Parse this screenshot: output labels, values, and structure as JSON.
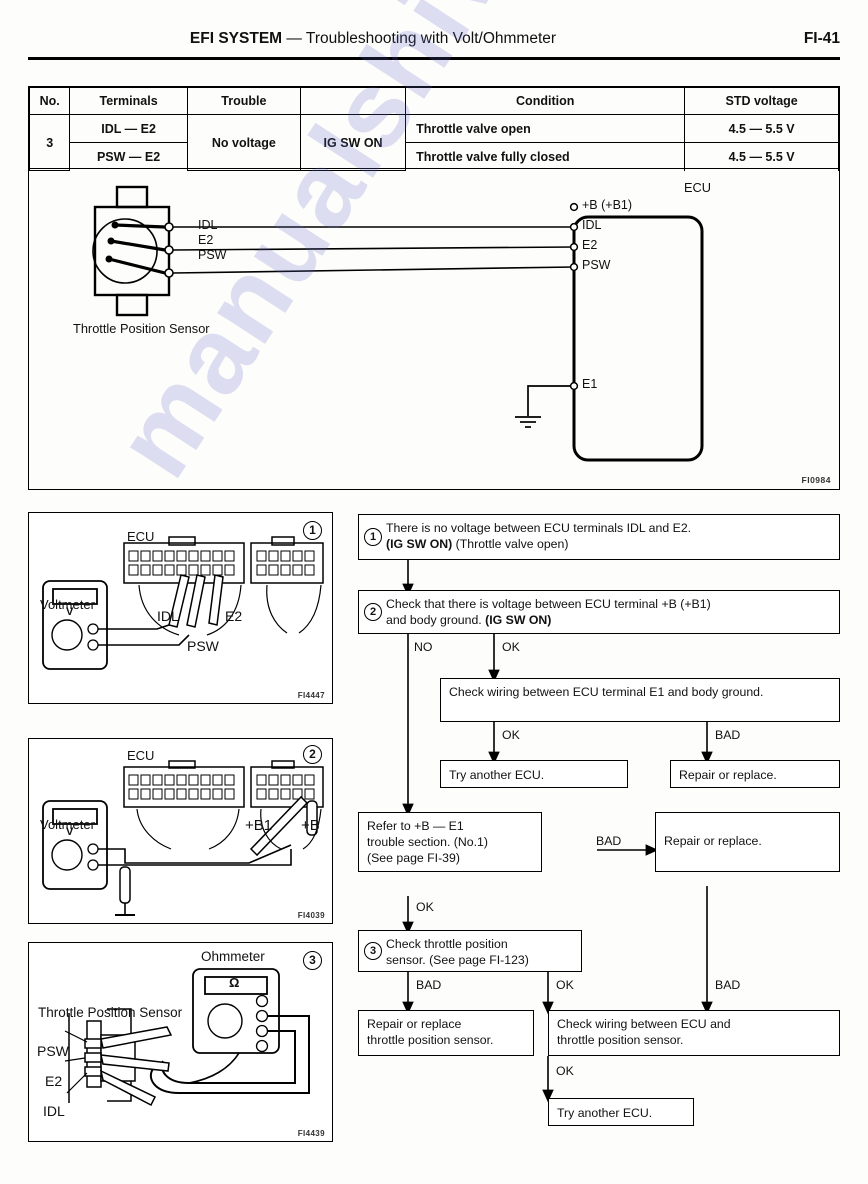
{
  "header": {
    "system": "EFI SYSTEM",
    "dash": "—",
    "subtitle": "Troubleshooting with Volt/Ohmmeter",
    "page": "FI-41"
  },
  "spec_table": {
    "columns": [
      "No.",
      "Terminals",
      "Trouble",
      "",
      "Condition",
      "STD voltage"
    ],
    "no": "3",
    "rows": [
      {
        "terminals": "IDL — E2",
        "trouble": "No voltage",
        "switch": "IG SW ON",
        "condition": "Throttle valve open",
        "std_voltage": "4.5 — 5.5 V"
      },
      {
        "terminals": "PSW — E2",
        "condition": "Throttle valve fully closed",
        "std_voltage": "4.5 — 5.5 V"
      }
    ]
  },
  "wiring_diagram": {
    "sensor_label": "Throttle Position Sensor",
    "ecu_label": "ECU",
    "sensor_terminals": [
      "IDL",
      "E2",
      "PSW"
    ],
    "ecu_terminals": [
      "+B (+B1)",
      "IDL",
      "E2",
      "PSW"
    ],
    "ecu_ground_terminal": "E1",
    "fig_code": "FI0984"
  },
  "illustrations": [
    {
      "num": "1",
      "meter_label": "Voltmeter",
      "meter_symbol": "V",
      "device_label": "ECU",
      "terminal_labels": [
        "IDL",
        "PSW",
        "E2"
      ],
      "fig_code": "FI4447"
    },
    {
      "num": "2",
      "meter_label": "Voltmeter",
      "meter_symbol": "V",
      "device_label": "ECU",
      "terminal_labels": [
        "+B1",
        "+B"
      ],
      "fig_code": "FI4039"
    },
    {
      "num": "3",
      "meter_label": "Ohmmeter",
      "meter_symbol": "Ω",
      "device_label": "Throttle Position Sensor",
      "terminal_labels": [
        "PSW",
        "E2",
        "IDL"
      ],
      "fig_code": "FI4439"
    }
  ],
  "flowchart": {
    "step1": {
      "num": "1",
      "line1": "There is no voltage between ECU terminals IDL and E2.",
      "bold": "(IG SW ON)",
      "tail": " (Throttle valve open)"
    },
    "step2": {
      "num": "2",
      "line1": "Check that there is voltage between ECU terminal +B (+B1)",
      "line2a": "and body ground. ",
      "bold": "(IG SW ON)"
    },
    "check_e1": "Check wiring between ECU terminal E1 and body ground.",
    "try_ecu_1": "Try another ECU.",
    "repair_1": "Repair or replace.",
    "refer_b_e1": {
      "line1": "Refer to +B — E1",
      "line2": "trouble section. (No.1)",
      "line3": "(See page FI-39)"
    },
    "repair_2": "Repair or replace.",
    "step3": {
      "num": "3",
      "line1": "Check throttle position",
      "line2": "sensor. (See page FI-123)"
    },
    "repair_tps": {
      "line1": "Repair or replace",
      "line2": "throttle position sensor."
    },
    "check_wiring_tps": {
      "line1": "Check wiring between ECU and",
      "line2": "throttle position sensor."
    },
    "try_ecu_2": "Try another ECU.",
    "labels": {
      "no": "NO",
      "ok": "OK",
      "bad": "BAD"
    }
  },
  "watermark": {
    "text": "manualshive.com"
  }
}
